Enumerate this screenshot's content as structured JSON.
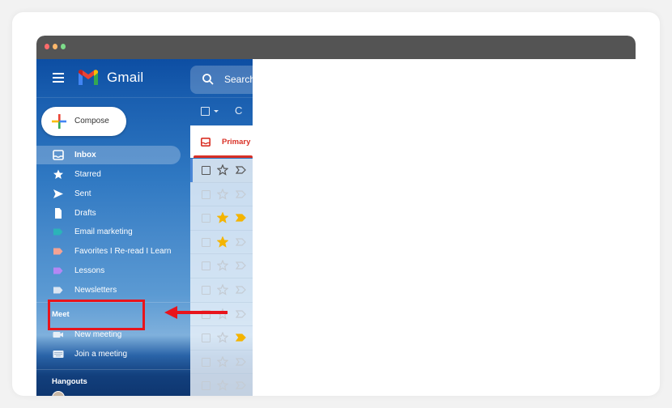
{
  "window": {
    "traffic_lights": [
      "#ff6b6b",
      "#ffb86b",
      "#7ddc8a"
    ]
  },
  "gmail": {
    "brand": "Gmail",
    "menu_icon": "hamburger-menu-icon",
    "logo_icon": "gmail-m-logo-icon",
    "search": {
      "icon": "search-icon",
      "placeholder": "Search"
    },
    "compose": {
      "label": "Compose",
      "icon": "multicolor-plus-icon"
    },
    "nav": [
      {
        "label": "Inbox",
        "icon": "inbox-icon",
        "active": true
      },
      {
        "label": "Starred",
        "icon": "star-icon",
        "active": false
      },
      {
        "label": "Sent",
        "icon": "send-icon",
        "active": false
      },
      {
        "label": "Drafts",
        "icon": "draft-file-icon",
        "active": false
      },
      {
        "label": "Email marketing",
        "icon": "label-icon",
        "color": "#2bb3b8",
        "active": false
      },
      {
        "label": "Favorites I Re-read I Learn",
        "icon": "label-icon",
        "color": "#f4a394",
        "active": false
      },
      {
        "label": "Lessons",
        "icon": "label-icon",
        "color": "#b487f4",
        "active": false
      },
      {
        "label": "Newsletters",
        "icon": "label-icon",
        "color": "#dce6f2",
        "active": false
      }
    ],
    "meet": {
      "title": "Meet",
      "items": [
        {
          "label": "New meeting",
          "icon": "video-camera-icon"
        },
        {
          "label": "Join a meeting",
          "icon": "keyboard-icon"
        }
      ]
    },
    "hangouts": {
      "title": "Hangouts"
    },
    "toolbar": {
      "select_icon": "checkbox-icon",
      "dropdown_icon": "caret-down-icon",
      "refresh_icon": "refresh-icon",
      "refresh_glyph": "C"
    },
    "tabs": [
      {
        "label": "Primary",
        "icon": "inbox-tray-icon",
        "active": true,
        "color": "#d93025"
      }
    ],
    "rows": [
      {
        "starred": false,
        "important": false
      },
      {
        "starred": false,
        "important": false
      },
      {
        "starred": true,
        "important": true
      },
      {
        "starred": true,
        "important": false
      },
      {
        "starred": false,
        "important": false
      },
      {
        "starred": false,
        "important": false
      },
      {
        "starred": false,
        "important": false
      },
      {
        "starred": false,
        "important": true
      },
      {
        "starred": false,
        "important": false
      },
      {
        "starred": false,
        "important": false
      }
    ]
  },
  "annotation": {
    "highlight_target": "Newsletters",
    "color": "#e8141c"
  },
  "colors": {
    "star_yellow": "#f4b400",
    "important_yellow": "#f4b400",
    "primary_red": "#d93025"
  }
}
